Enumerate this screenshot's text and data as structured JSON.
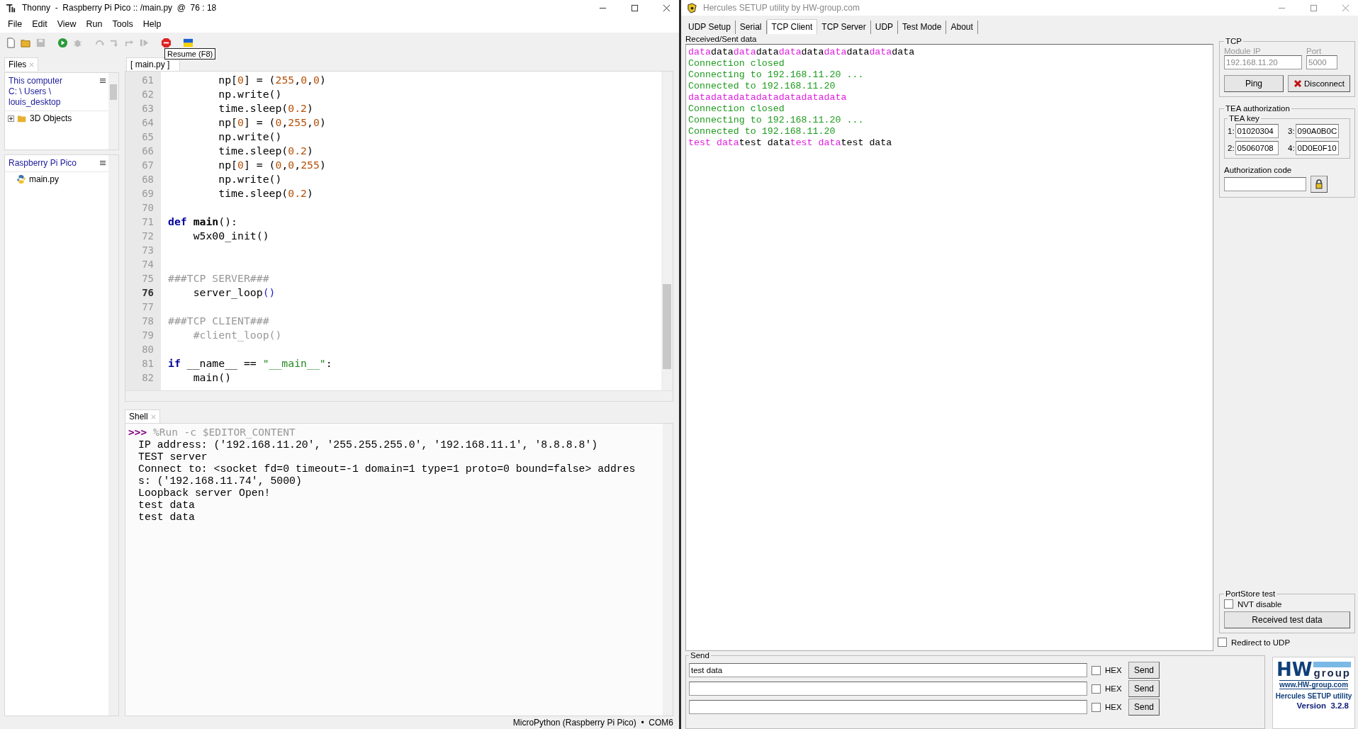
{
  "thonny": {
    "title": "Thonny  -  Raspberry Pi Pico :: /main.py  @  76 : 18",
    "menu": [
      "File",
      "Edit",
      "View",
      "Run",
      "Tools",
      "Help"
    ],
    "tooltip": "Resume (F8)",
    "files_tab": "Files",
    "this_computer": {
      "heading": "This computer",
      "path": [
        "C: \\ Users \\",
        "louis_desktop"
      ],
      "items": [
        {
          "label": "3D Objects",
          "expanded": false
        }
      ]
    },
    "device": {
      "heading": "Raspberry Pi Pico",
      "items": [
        {
          "label": "main.py"
        }
      ]
    },
    "editor_tab": "[ main.py ]",
    "code_lines": [
      {
        "number": "61",
        "current": false,
        "tokens": [
          {
            "text": "        np[",
            "kind": "plain"
          },
          {
            "text": "0",
            "kind": "number"
          },
          {
            "text": "] = (",
            "kind": "plain"
          },
          {
            "text": "255",
            "kind": "number"
          },
          {
            "text": ",",
            "kind": "plain"
          },
          {
            "text": "0",
            "kind": "number"
          },
          {
            "text": ",",
            "kind": "plain"
          },
          {
            "text": "0",
            "kind": "number"
          },
          {
            "text": ")",
            "kind": "plain"
          }
        ]
      },
      {
        "number": "62",
        "current": false,
        "tokens": [
          {
            "text": "        np.write()",
            "kind": "plain"
          }
        ]
      },
      {
        "number": "63",
        "current": false,
        "tokens": [
          {
            "text": "        time.sleep(",
            "kind": "plain"
          },
          {
            "text": "0.2",
            "kind": "number"
          },
          {
            "text": ")",
            "kind": "plain"
          }
        ]
      },
      {
        "number": "64",
        "current": false,
        "tokens": [
          {
            "text": "        np[",
            "kind": "plain"
          },
          {
            "text": "0",
            "kind": "number"
          },
          {
            "text": "] = (",
            "kind": "plain"
          },
          {
            "text": "0",
            "kind": "number"
          },
          {
            "text": ",",
            "kind": "plain"
          },
          {
            "text": "255",
            "kind": "number"
          },
          {
            "text": ",",
            "kind": "plain"
          },
          {
            "text": "0",
            "kind": "number"
          },
          {
            "text": ")",
            "kind": "plain"
          }
        ]
      },
      {
        "number": "65",
        "current": false,
        "tokens": [
          {
            "text": "        np.write()",
            "kind": "plain"
          }
        ]
      },
      {
        "number": "66",
        "current": false,
        "tokens": [
          {
            "text": "        time.sleep(",
            "kind": "plain"
          },
          {
            "text": "0.2",
            "kind": "number"
          },
          {
            "text": ")",
            "kind": "plain"
          }
        ]
      },
      {
        "number": "67",
        "current": false,
        "tokens": [
          {
            "text": "        np[",
            "kind": "plain"
          },
          {
            "text": "0",
            "kind": "number"
          },
          {
            "text": "] = (",
            "kind": "plain"
          },
          {
            "text": "0",
            "kind": "number"
          },
          {
            "text": ",",
            "kind": "plain"
          },
          {
            "text": "0",
            "kind": "number"
          },
          {
            "text": ",",
            "kind": "plain"
          },
          {
            "text": "255",
            "kind": "number"
          },
          {
            "text": ")",
            "kind": "plain"
          }
        ]
      },
      {
        "number": "68",
        "current": false,
        "tokens": [
          {
            "text": "        np.write()",
            "kind": "plain"
          }
        ]
      },
      {
        "number": "69",
        "current": false,
        "tokens": [
          {
            "text": "        time.sleep(",
            "kind": "plain"
          },
          {
            "text": "0.2",
            "kind": "number"
          },
          {
            "text": ")",
            "kind": "plain"
          }
        ]
      },
      {
        "number": "70",
        "current": false
      },
      {
        "number": "71",
        "current": false,
        "tokens": [
          {
            "text": "def",
            "kind": "keyword"
          },
          {
            "text": " main",
            "kind": "definition"
          },
          {
            "text": "():",
            "kind": "plain"
          }
        ]
      },
      {
        "number": "72",
        "current": false,
        "tokens": [
          {
            "text": "    w5x00_init()",
            "kind": "plain"
          }
        ]
      },
      {
        "number": "73",
        "current": false
      },
      {
        "number": "74",
        "current": false
      },
      {
        "number": "75",
        "current": false,
        "tokens": [
          {
            "text": "###TCP SERVER###",
            "kind": "comment"
          }
        ]
      },
      {
        "number": "76",
        "current": true,
        "tokens": [
          {
            "text": "    server_loop",
            "kind": "plain"
          },
          {
            "text": "()",
            "kind": "bracket"
          }
        ]
      },
      {
        "number": "77",
        "current": false
      },
      {
        "number": "78",
        "current": false,
        "tokens": [
          {
            "text": "###TCP CLIENT###",
            "kind": "comment"
          }
        ]
      },
      {
        "number": "79",
        "current": false,
        "tokens": [
          {
            "text": "    #client_loop()",
            "kind": "comment"
          }
        ]
      },
      {
        "number": "80",
        "current": false
      },
      {
        "number": "81",
        "current": false,
        "tokens": [
          {
            "text": "if",
            "kind": "keyword"
          },
          {
            "text": " __name__ == ",
            "kind": "plain"
          },
          {
            "text": "\"__main__\"",
            "kind": "string"
          },
          {
            "text": ":",
            "kind": "plain"
          }
        ]
      },
      {
        "number": "82",
        "current": false,
        "tokens": [
          {
            "text": "    main()",
            "kind": "plain"
          }
        ]
      }
    ],
    "shell_tab": "Shell",
    "shell": {
      "prompt": ">>>",
      "command": "%Run -c $EDITOR_CONTENT",
      "output": [
        "IP address: ('192.168.11.20', '255.255.255.0', '192.168.11.1', '8.8.8.8')",
        "TEST server",
        "Connect to: <socket fd=0 timeout=-1 domain=1 type=1 proto=0 bound=false> addres",
        "s: ('192.168.11.74', 5000)",
        "Loopback server Open!",
        "test data",
        "test data"
      ]
    },
    "status_bar": "MicroPython (Raspberry Pi Pico)  •  COM6"
  },
  "hercules": {
    "title": "Hercules SETUP utility by HW-group.com",
    "tabs": [
      {
        "label": "UDP Setup",
        "selected": false
      },
      {
        "label": "Serial",
        "selected": false
      },
      {
        "label": "TCP Client",
        "selected": true
      },
      {
        "label": "TCP Server",
        "selected": false
      },
      {
        "label": "UDP",
        "selected": false
      },
      {
        "label": "Test Mode",
        "selected": false
      },
      {
        "label": "About",
        "selected": false
      }
    ],
    "received_label": "Received/Sent data",
    "received_lines": [
      {
        "segments": [
          {
            "text": "data",
            "kind": "sent"
          },
          {
            "text": "data",
            "kind": "received"
          },
          {
            "text": "data",
            "kind": "sent"
          },
          {
            "text": "data",
            "kind": "received"
          },
          {
            "text": "data",
            "kind": "sent"
          },
          {
            "text": "data",
            "kind": "received"
          },
          {
            "text": "data",
            "kind": "sent"
          },
          {
            "text": "data",
            "kind": "received"
          },
          {
            "text": "data",
            "kind": "sent"
          },
          {
            "text": "data",
            "kind": "received"
          }
        ]
      },
      {
        "segments": [
          {
            "text": "Connection closed",
            "kind": "status"
          }
        ]
      },
      {
        "segments": [
          {
            "text": "Connecting to 192.168.11.20 ...",
            "kind": "status"
          }
        ]
      },
      {
        "segments": [
          {
            "text": "Connected to 192.168.11.20",
            "kind": "status"
          }
        ]
      },
      {
        "segments": [
          {
            "text": "datadatadatadatadatadatadata",
            "kind": "sent"
          }
        ]
      },
      {
        "segments": [
          {
            "text": "Connection closed",
            "kind": "status"
          }
        ]
      },
      {
        "segments": [
          {
            "text": "Connecting to 192.168.11.20 ...",
            "kind": "status"
          }
        ]
      },
      {
        "segments": [
          {
            "text": "Connected to 192.168.11.20",
            "kind": "status"
          }
        ]
      },
      {
        "segments": [
          {
            "text": "test data",
            "kind": "sent"
          },
          {
            "text": "test data",
            "kind": "received"
          },
          {
            "text": "test data",
            "kind": "sent"
          },
          {
            "text": "test data",
            "kind": "received"
          }
        ]
      }
    ],
    "tcp": {
      "legend": "TCP",
      "module_ip_label": "Module IP",
      "module_ip": "192.168.11.20",
      "port_label": "Port",
      "port": "5000",
      "disabled": true,
      "ping": "Ping",
      "disconnect": "Disconnect"
    },
    "tea": {
      "legend": "TEA authorization",
      "key_legend": "TEA key",
      "keys": [
        {
          "index": "1:",
          "value": "01020304"
        },
        {
          "index": "3:",
          "value": "090A0B0C"
        },
        {
          "index": "2:",
          "value": "05060708"
        },
        {
          "index": "4:",
          "value": "0D0E0F10"
        }
      ],
      "auth_label": "Authorization code"
    },
    "portstore": {
      "legend": "PortStore test",
      "nvt": {
        "label": "NVT disable",
        "checked": false
      },
      "button": "Received test data"
    },
    "redirect": {
      "label": "Redirect to UDP",
      "checked": false
    },
    "send": {
      "legend": "Send",
      "rows": [
        {
          "value": "test data",
          "hex": {
            "label": "HEX",
            "checked": false
          },
          "button": "Send"
        },
        {
          "hex": {
            "label": "HEX",
            "checked": false
          },
          "button": "Send"
        },
        {
          "hex": {
            "label": "HEX",
            "checked": false
          },
          "button": "Send"
        }
      ]
    },
    "logo": {
      "brand_left": "HW",
      "brand_right": "group",
      "url": "www.HW-group.com",
      "product": "Hercules SETUP utility",
      "version": "Version  3.2.8"
    }
  }
}
